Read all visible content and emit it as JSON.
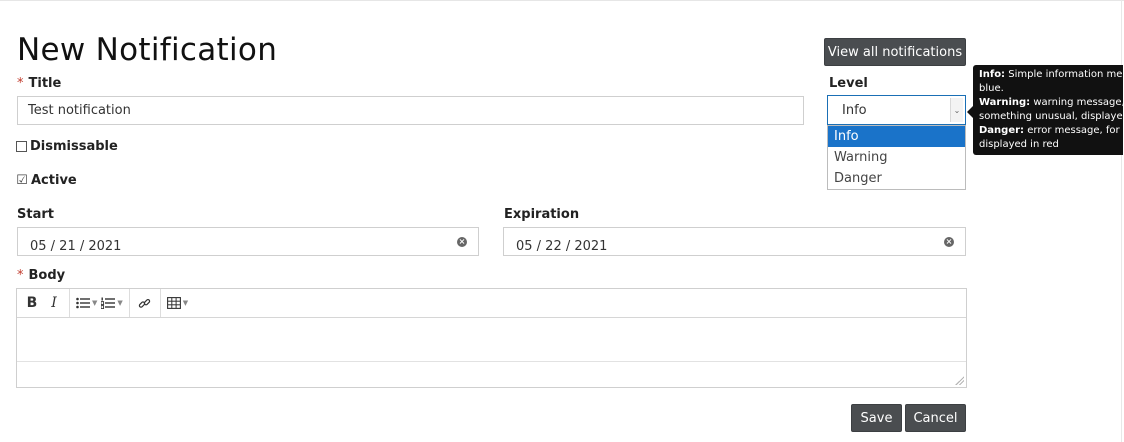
{
  "page": {
    "title": "New Notification"
  },
  "header": {
    "view_all_label": "View all notifications"
  },
  "form": {
    "title": {
      "required_mark": "*",
      "label": "Title",
      "value": "Test notification"
    },
    "level": {
      "label": "Level",
      "selected": "Info",
      "options": [
        "Info",
        "Warning",
        "Danger"
      ]
    },
    "tooltip": {
      "lines": [
        {
          "bold": "Info:",
          "text": " Simple information me"
        },
        {
          "bold": "",
          "text": "blue."
        },
        {
          "bold": "Warning:",
          "text": " warning message,"
        },
        {
          "bold": "",
          "text": "something unusual, displaye"
        },
        {
          "bold": "Danger:",
          "text": " error message, for"
        },
        {
          "bold": "",
          "text": "displayed in red"
        }
      ]
    },
    "dismissable": {
      "label": "Dismissable",
      "checked": false
    },
    "active": {
      "label": "Active",
      "checked": true,
      "check_glyph": "☑"
    },
    "start": {
      "label": "Start",
      "value": "05 / 21 / 2021"
    },
    "expiration": {
      "label": "Expiration",
      "value": "05 / 22 / 2021"
    },
    "body": {
      "required_mark": "*",
      "label": "Body",
      "value": ""
    }
  },
  "editor_toolbar": {
    "bold": "B",
    "italic": "I",
    "icons": [
      "bold-icon",
      "italic-icon",
      "bulleted-list-icon",
      "numbered-list-icon",
      "link-icon",
      "table-icon"
    ]
  },
  "actions": {
    "save_label": "Save",
    "cancel_label": "Cancel"
  },
  "colors": {
    "accent": "#1a73c9",
    "button_dark": "#4a4d50",
    "required": "#c0392b",
    "tooltip_bg": "#111111"
  }
}
